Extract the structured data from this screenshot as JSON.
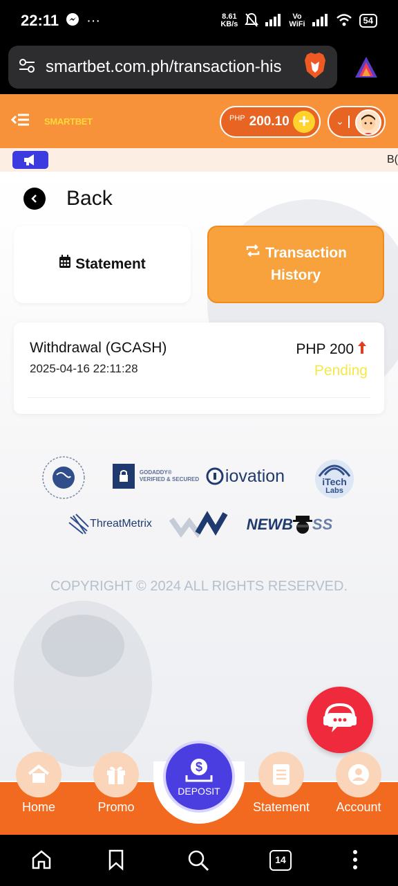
{
  "status_bar": {
    "time": "22:11",
    "more": "···",
    "speed_value": "8.61",
    "speed_unit": "KB/s",
    "vo_label": "Vo",
    "wifi_label": "WiFi",
    "battery": "54"
  },
  "browser": {
    "url": "smartbet.com.ph/transaction-his",
    "tab_count": "14"
  },
  "header": {
    "logo": "SMARTBET",
    "currency": "PHP",
    "balance": "200.10"
  },
  "marquee": {
    "text": "B("
  },
  "page": {
    "back_label": "Back",
    "tabs": [
      {
        "label": "Statement"
      },
      {
        "label_line1": "Transaction",
        "label_line2": "History"
      }
    ]
  },
  "transaction": {
    "type": "Withdrawal (GCASH)",
    "datetime": "2025-04-16 22:11:28",
    "amount": "PHP 200",
    "status": "Pending"
  },
  "partners": {
    "godaddy_line1": "GODADDY®",
    "godaddy_line2": "VERIFIED & SECURED",
    "iovation": "iovation",
    "itech_line1": "iTech",
    "itech_line2": "Labs",
    "threatmetrix": "ThreatMetrix",
    "newboss": "NEWB",
    "newboss_end": "SS"
  },
  "footer": {
    "copyright": "COPYRIGHT © 2024 ALL RIGHTS RESERVED."
  },
  "bottom_nav": {
    "home": "Home",
    "promo": "Promo",
    "deposit": "DEPOSIT",
    "statement": "Statement",
    "account": "Account"
  },
  "colors": {
    "brand_orange": "#f7923a",
    "nav_orange": "#f26a1f",
    "deposit_purple": "#4b3ee0",
    "chat_red": "#ee2a3c",
    "pending_yellow": "#f4e84a"
  }
}
